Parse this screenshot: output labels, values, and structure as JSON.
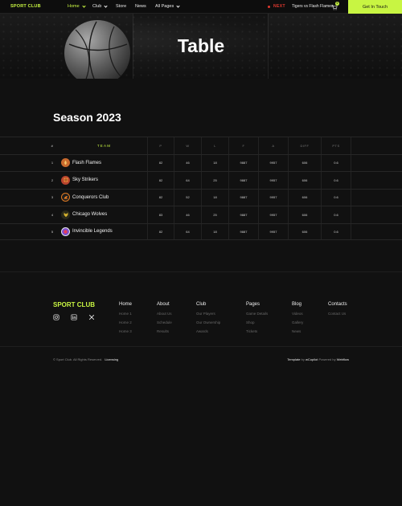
{
  "nav": {
    "logo": "SPORT CLUB",
    "links": [
      {
        "label": "Home",
        "has_dropdown": true,
        "active": true
      },
      {
        "label": "Club",
        "has_dropdown": true,
        "active": false
      },
      {
        "label": "Store",
        "has_dropdown": false,
        "active": false
      },
      {
        "label": "News",
        "has_dropdown": false,
        "active": false
      },
      {
        "label": "All Pages",
        "has_dropdown": true,
        "active": false
      }
    ],
    "next_label": "NEXT",
    "next_match": "Tigers vs Flash Flames",
    "cart_count": "0",
    "cta_label": "Get In Touch"
  },
  "hero": {
    "title": "Table"
  },
  "season": {
    "title": "Season 2023"
  },
  "table": {
    "headers": [
      "#",
      "TEAM",
      "P",
      "W",
      "L",
      "F",
      "A",
      "DIFF",
      "PTS"
    ],
    "rows": [
      {
        "rank": "1",
        "team": "Flash Flames",
        "logo_color": "#c96a2e",
        "values": [
          "82",
          "46",
          "18",
          "9887",
          "9957",
          "606",
          "0.6"
        ]
      },
      {
        "rank": "2",
        "team": "Sky Strikers",
        "logo_color": "#b8432e",
        "values": [
          "82",
          "64",
          "25",
          "9887",
          "9957",
          "606",
          "0.6"
        ]
      },
      {
        "rank": "3",
        "team": "Conquerors Club",
        "logo_color": "#e07a22",
        "values": [
          "82",
          "52",
          "18",
          "9887",
          "9957",
          "606",
          "0.6"
        ]
      },
      {
        "rank": "4",
        "team": "Chicago Wolves",
        "logo_color": "#d6b22e",
        "values": [
          "83",
          "46",
          "25",
          "9887",
          "9957",
          "606",
          "0.6"
        ]
      },
      {
        "rank": "5",
        "team": "Invincible Legends",
        "logo_color": "#7b4fd0",
        "values": [
          "82",
          "64",
          "18",
          "9887",
          "9957",
          "606",
          "0.6"
        ]
      }
    ]
  },
  "footer": {
    "brand": "SPORT CLUB",
    "social": [
      "instagram-icon",
      "linkedin-icon",
      "x-icon"
    ],
    "columns": [
      {
        "title": "Home",
        "links": [
          "Home 1",
          "Home 2",
          "Home 3"
        ]
      },
      {
        "title": "About",
        "links": [
          "About Us",
          "Schedule",
          "Results"
        ]
      },
      {
        "title": "Club",
        "links": [
          "Our Players",
          "Our Ownership",
          "Awards"
        ]
      },
      {
        "title": "Pages",
        "links": [
          "Game Details",
          "Shop",
          "Tickets"
        ]
      },
      {
        "title": "Blog",
        "links": [
          "Videos",
          "Gallery",
          "News"
        ]
      },
      {
        "title": "Contacts",
        "links": [
          "Contact Us"
        ]
      }
    ],
    "copyright": "© Sport Club. All Rights Reserved.",
    "licensing": "Licensing",
    "credit_prefix": "Template",
    "credit_by": "by",
    "credit_author": "wCopilot",
    "credit_powered": "Powered by",
    "credit_platform": "Webflow"
  },
  "colors": {
    "accent": "#c8f542",
    "background": "#111111",
    "next": "#e0392f"
  }
}
